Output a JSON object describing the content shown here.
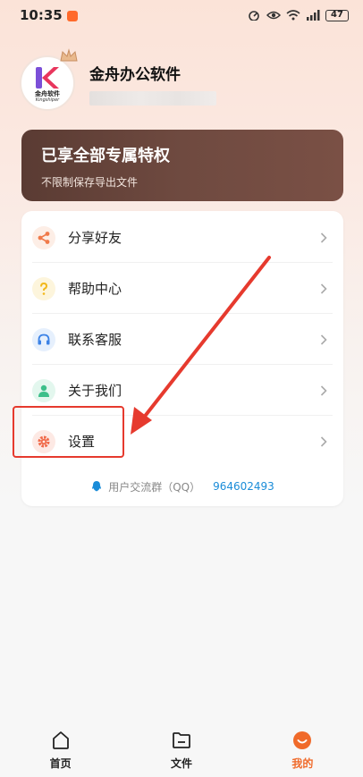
{
  "status_bar": {
    "time": "10:35",
    "battery": "47"
  },
  "profile": {
    "name": "金舟办公软件",
    "avatar_text": "金舟软件",
    "avatar_sub": "Kingshiper"
  },
  "vip_banner": {
    "title": "已享全部专属特权",
    "subtitle": "不限制保存导出文件"
  },
  "menu": {
    "items": [
      {
        "label": "分享好友",
        "icon": "share-icon",
        "color": "#f07a4a",
        "bg": "#fdeee6"
      },
      {
        "label": "帮助中心",
        "icon": "help-icon",
        "color": "#f2b81a",
        "bg": "#fdf5dc"
      },
      {
        "label": "联系客服",
        "icon": "headset-icon",
        "color": "#3b82e6",
        "bg": "#e6f0fd"
      },
      {
        "label": "关于我们",
        "icon": "user-icon",
        "color": "#3cbf8a",
        "bg": "#e3f7ee"
      },
      {
        "label": "设置",
        "icon": "gear-icon",
        "color": "#f06a4a",
        "bg": "#fde9e4"
      }
    ],
    "qq_label": "用户交流群（QQ）",
    "qq_number": "964602493"
  },
  "bottom_nav": {
    "items": [
      {
        "label": "首页",
        "icon": "home-icon"
      },
      {
        "label": "文件",
        "icon": "folder-icon"
      },
      {
        "label": "我的",
        "icon": "profile-icon",
        "active": true
      }
    ]
  },
  "colors": {
    "accent": "#f06a2a",
    "vip_bg": "#5a3b33",
    "annotation": "#e63a2e",
    "link": "#1a8cd8"
  }
}
